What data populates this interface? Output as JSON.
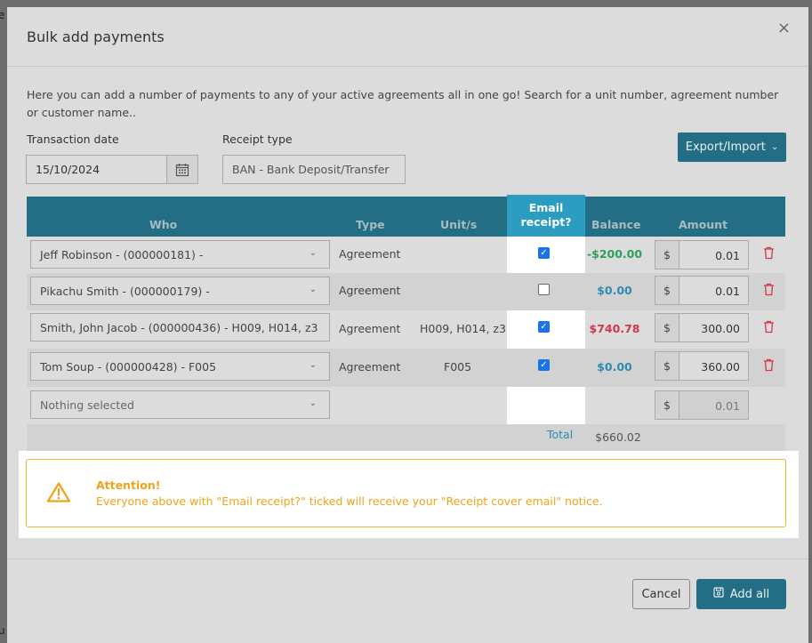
{
  "modal": {
    "title": "Bulk add payments",
    "close_icon": "×",
    "intro": "Here you can add a number of payments to any of your active agreements all in one go! Search for a unit number, agreement number or customer name.."
  },
  "form": {
    "transaction_date_label": "Transaction date",
    "transaction_date_value": "15/10/2024",
    "receipt_type_label": "Receipt type",
    "receipt_type_value": "BAN - Bank Deposit/Transfer",
    "export_import_label": "Export/Import",
    "export_import_chevron": "⌄"
  },
  "table": {
    "headers": {
      "who": "Who",
      "type": "Type",
      "units": "Unit/s",
      "email_receipt": "Email receipt?",
      "balance": "Balance",
      "amount": "Amount"
    },
    "rows": [
      {
        "who": "Jeff Robinson - (000000181) -",
        "type": "Agreement",
        "units": "",
        "email_receipt": true,
        "balance": "-$200.00",
        "balance_color": "#2e9e5b",
        "currency": "$",
        "amount": "0.01"
      },
      {
        "who": "Pikachu Smith - (000000179) -",
        "type": "Agreement",
        "units": "",
        "email_receipt": false,
        "balance": "$0.00",
        "balance_color": "#2c8cb0",
        "currency": "$",
        "amount": "0.01"
      },
      {
        "who": "Smith, John Jacob - (000000436) - H009, H014, z3",
        "type": "Agreement",
        "units": "H009, H014, z3",
        "email_receipt": true,
        "balance": "$740.78",
        "balance_color": "#d0374b",
        "currency": "$",
        "amount": "300.00"
      },
      {
        "who": "Tom Soup - (000000428) - F005",
        "type": "Agreement",
        "units": "F005",
        "email_receipt": true,
        "balance": "$0.00",
        "balance_color": "#2c8cb0",
        "currency": "$",
        "amount": "360.00"
      }
    ],
    "empty_row": {
      "who_placeholder": "Nothing selected",
      "currency": "$",
      "amount": "0.01"
    },
    "total_label": "Total",
    "total_value": "$660.02"
  },
  "alert": {
    "icon": "warning-triangle-icon",
    "title": "Attention!",
    "message": "Everyone above with \"Email receipt?\" ticked will receive your \"Receipt cover email\" notice."
  },
  "footer": {
    "cancel_label": "Cancel",
    "add_all_label": "Add all"
  },
  "colors": {
    "primary": "#236e84",
    "email_header": "#2c9cc0",
    "warning": "#f0a31a",
    "danger": "#d0374b"
  }
}
